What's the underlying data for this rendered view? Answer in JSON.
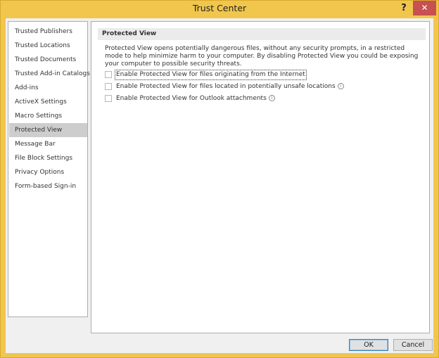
{
  "window": {
    "title": "Trust Center",
    "help_label": "?",
    "close_label": "✕"
  },
  "sidebar": {
    "items": [
      {
        "label": "Trusted Publishers"
      },
      {
        "label": "Trusted Locations"
      },
      {
        "label": "Trusted Documents"
      },
      {
        "label": "Trusted Add-in Catalogs"
      },
      {
        "label": "Add-ins"
      },
      {
        "label": "ActiveX Settings"
      },
      {
        "label": "Macro Settings"
      },
      {
        "label": "Protected View",
        "selected": true
      },
      {
        "label": "Message Bar"
      },
      {
        "label": "File Block Settings"
      },
      {
        "label": "Privacy Options"
      },
      {
        "label": "Form-based Sign-in"
      }
    ]
  },
  "main": {
    "section_title": "Protected View",
    "description": "Protected View opens potentially dangerous files, without any security prompts, in a restricted mode to help minimize harm to your computer. By disabling Protected View you could be exposing your computer to possible security threats.",
    "options": [
      {
        "label": "Enable Protected View for files originating from the Internet",
        "checked": false
      },
      {
        "label": "Enable Protected View for files located in potentially unsafe locations",
        "checked": false,
        "info_icon": "info-icon"
      },
      {
        "label": "Enable Protected View for Outlook attachments",
        "checked": false,
        "info_icon": "info-icon"
      }
    ]
  },
  "footer": {
    "ok_label": "OK",
    "cancel_label": "Cancel"
  }
}
